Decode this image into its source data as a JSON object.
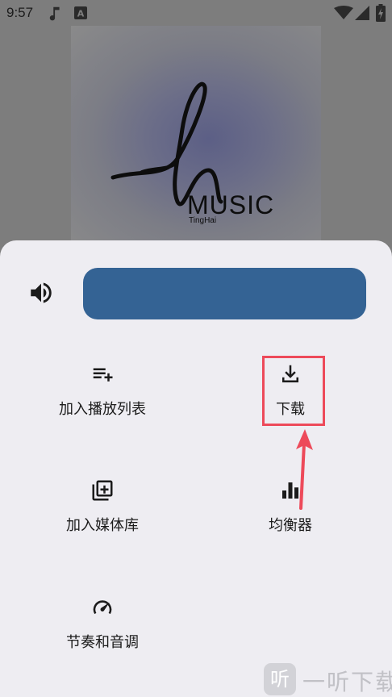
{
  "status_bar": {
    "time": "9:57",
    "left_icons": [
      "music-note-icon",
      "a-box-icon"
    ],
    "right_icons": [
      "wifi-icon",
      "signal-icon",
      "battery-charging-icon"
    ]
  },
  "album": {
    "logo_text": "MUSIC",
    "logo_subtext": "TingHai"
  },
  "sheet": {
    "volume_icon": "volume-icon",
    "volume_level": 1.0,
    "actions": [
      {
        "label": "加入播放列表",
        "icon": "playlist-add-icon"
      },
      {
        "label": "下载",
        "icon": "download-icon"
      },
      {
        "label": "加入媒体库",
        "icon": "library-add-icon"
      },
      {
        "label": "均衡器",
        "icon": "equalizer-icon"
      },
      {
        "label": "节奏和音调",
        "icon": "speed-icon"
      }
    ]
  },
  "watermark": {
    "badge": "听",
    "text": "一听下载"
  },
  "colors": {
    "sheet_bg": "#eeedf2",
    "slider": "#346394",
    "highlight": "#ed4a5a",
    "scrim": "#7d7d7d"
  }
}
